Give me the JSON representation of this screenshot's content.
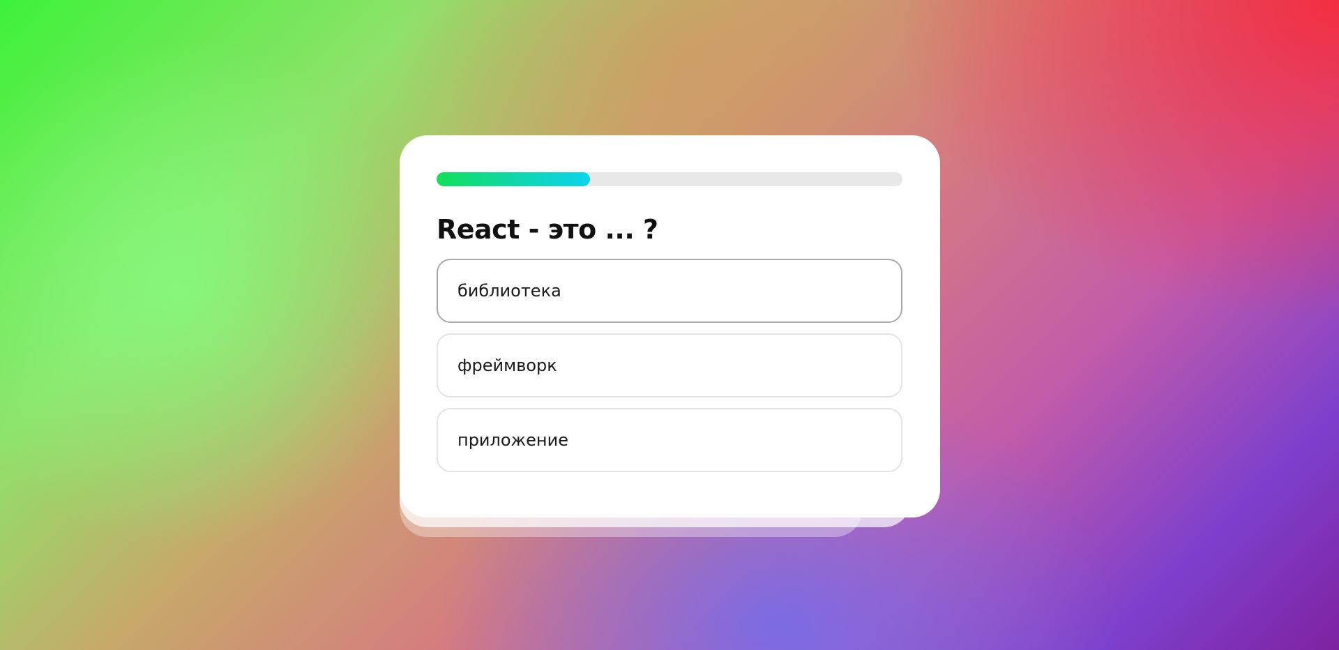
{
  "quiz": {
    "progress": 0.33,
    "progress_colors": [
      "#12e05a",
      "#0cd4ee"
    ],
    "question": "React - это ... ?",
    "answers": [
      {
        "label": "библиотека",
        "hovered": true
      },
      {
        "label": "фреймворк",
        "hovered": false
      },
      {
        "label": "приложение",
        "hovered": false
      }
    ]
  }
}
